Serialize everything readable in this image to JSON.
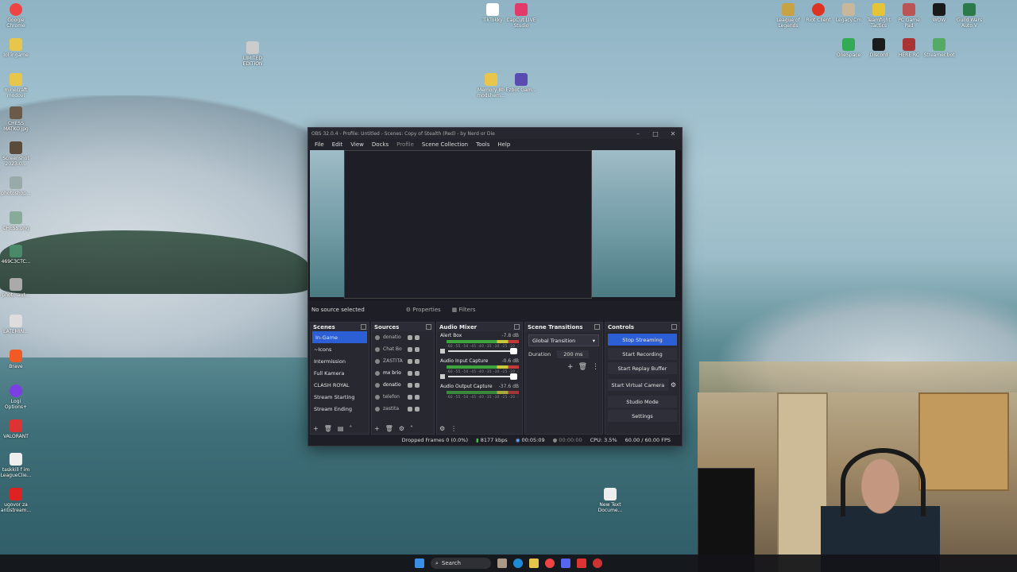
{
  "desktop": {
    "left_icons": [
      {
        "label": "Google Chrome"
      },
      {
        "label": "lol ingame"
      },
      {
        "label": "minecraft modovi"
      },
      {
        "label": "CHESS MATKO.jpg"
      },
      {
        "label": "Screenshot 2023-0..."
      },
      {
        "label": "photoshop..."
      },
      {
        "label": "CHESS.png"
      },
      {
        "label": "469C3CTC..."
      },
      {
        "label": "photo-aut..."
      },
      {
        "label": "LATEMIN..."
      },
      {
        "label": "Brave"
      },
      {
        "label": "Logi Options+"
      },
      {
        "label": "VALORANT"
      },
      {
        "label": "taskkill f im LeagueClie..."
      },
      {
        "label": "ugovor za antistream..."
      }
    ],
    "top_icons": [
      {
        "label": "LIMITED EDITION"
      },
      {
        "label": "TikTokky"
      },
      {
        "label": "CapCut LIVE Studio"
      },
      {
        "label": "Memory 8b modshem..."
      },
      {
        "label": "Ezbot Gam..."
      }
    ],
    "right_icons": [
      {
        "label": "League of Legends"
      },
      {
        "label": "Riot Client"
      },
      {
        "label": "Legacy.Cm"
      },
      {
        "label": "Teamfight Tactics"
      },
      {
        "label": "PC Game Pad"
      },
      {
        "label": "WOW"
      },
      {
        "label": "Guild Wars Auto V"
      },
      {
        "label": "OneSpace"
      },
      {
        "label": "Discord"
      },
      {
        "label": "HERE RC"
      },
      {
        "label": "Streamer.bot"
      }
    ],
    "bottom_icon": {
      "label": "New Text Docume..."
    }
  },
  "obs": {
    "title": "OBS 32.0.4 - Profile: Untitled - Scenes: Copy of Stealth (Red) - by Nerd or Die",
    "menu": [
      "File",
      "Edit",
      "View",
      "Docks",
      "Profile",
      "Scene Collection",
      "Tools",
      "Help"
    ],
    "no_source": "No source selected",
    "properties": "Properties",
    "filters": "Filters",
    "scenes_title": "Scenes",
    "scenes": [
      "In-Game",
      "~Icons",
      "Intermission",
      "Full Kamera",
      "CLASH ROYAL",
      "Stream Starting",
      "Stream Ending"
    ],
    "sources_title": "Sources",
    "sources": [
      "donatio",
      "Chat Bo",
      "ZASTITA",
      "mx brio",
      "donatio",
      "telefon",
      "zastita"
    ],
    "mixer_title": "Audio Mixer",
    "channels": [
      {
        "name": "Alert Box",
        "db": "-7.8 dB"
      },
      {
        "name": "Audio Input Capture",
        "db": "-0.6 dB"
      },
      {
        "name": "Audio Output Capture",
        "db": "-37.6 dB"
      }
    ],
    "scale": "-60 -55 -50 -45 -40 -35 -30 -25 -20 -15 -10 -5 0",
    "transitions_title": "Scene Transitions",
    "transition": "Global Transition",
    "duration_label": "Duration",
    "duration": "200 ms",
    "controls_title": "Controls",
    "controls": [
      "Stop Streaming",
      "Start Recording",
      "Start Replay Buffer",
      "Start Virtual Camera",
      "Studio Mode",
      "Settings"
    ],
    "status": {
      "dropped": "Dropped Frames 0 (0.0%)",
      "kbps": "8177 kbps",
      "stream_time": "00:05:09",
      "rec_time": "00:00:00",
      "cpu": "CPU: 3.5%",
      "fps": "60.00 / 60.00 FPS"
    }
  },
  "taskbar": {
    "search": "Search"
  }
}
